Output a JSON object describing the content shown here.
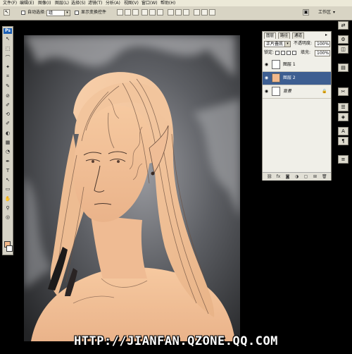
{
  "menu": {
    "items": [
      "文件(F)",
      "编辑(E)",
      "图像(I)",
      "图层(L)",
      "选择(S)",
      "滤镜(T)",
      "分析(A)",
      "视图(V)",
      "窗口(W)",
      "帮助(H)"
    ]
  },
  "options": {
    "auto_select_label": "自动选择:",
    "auto_select_value": "组",
    "show_transform_label": "显示变换控件",
    "workspace_label": "工作区"
  },
  "toolbox": {
    "logo": "Ps",
    "tools": [
      "↖",
      "⬚",
      "⌒",
      "✦",
      "⌗",
      "✎",
      "⊘",
      "✐",
      "⟲",
      "✐",
      "◐",
      "▦",
      "◔",
      "✒",
      "T",
      "↖",
      "▭",
      "✋",
      "⚲",
      "◎"
    ]
  },
  "layers_panel": {
    "tabs": [
      "图层",
      "路径",
      "通道"
    ],
    "blend_mode": "正片叠底",
    "opacity_label": "不透明度:",
    "opacity_value": "100%",
    "lock_label": "锁定:",
    "fill_label": "填充:",
    "fill_value": "100%",
    "layers": [
      {
        "name": "图层 1",
        "selected": false,
        "thumb": "#ffffff"
      },
      {
        "name": "图层 2",
        "selected": true,
        "thumb": "#f2b98b"
      },
      {
        "name": "背景",
        "selected": false,
        "thumb": "#ffffff",
        "italic": true
      }
    ],
    "footer_icons": [
      "⛓",
      "fx",
      "◙",
      "◑",
      "▢",
      "⊞",
      "🗑"
    ]
  },
  "right_dock": {
    "buttons": [
      "⇄",
      "⚙",
      "◫",
      "▤",
      "✂",
      "☰",
      "◈",
      "A",
      "¶",
      "≡"
    ]
  },
  "watermark": "HTTP://JIANFAN.QZONE.QQ.COM",
  "colors": {
    "foreground": "#f2b98b",
    "background": "#ffffff",
    "selected_layer": "#3d5e91"
  }
}
